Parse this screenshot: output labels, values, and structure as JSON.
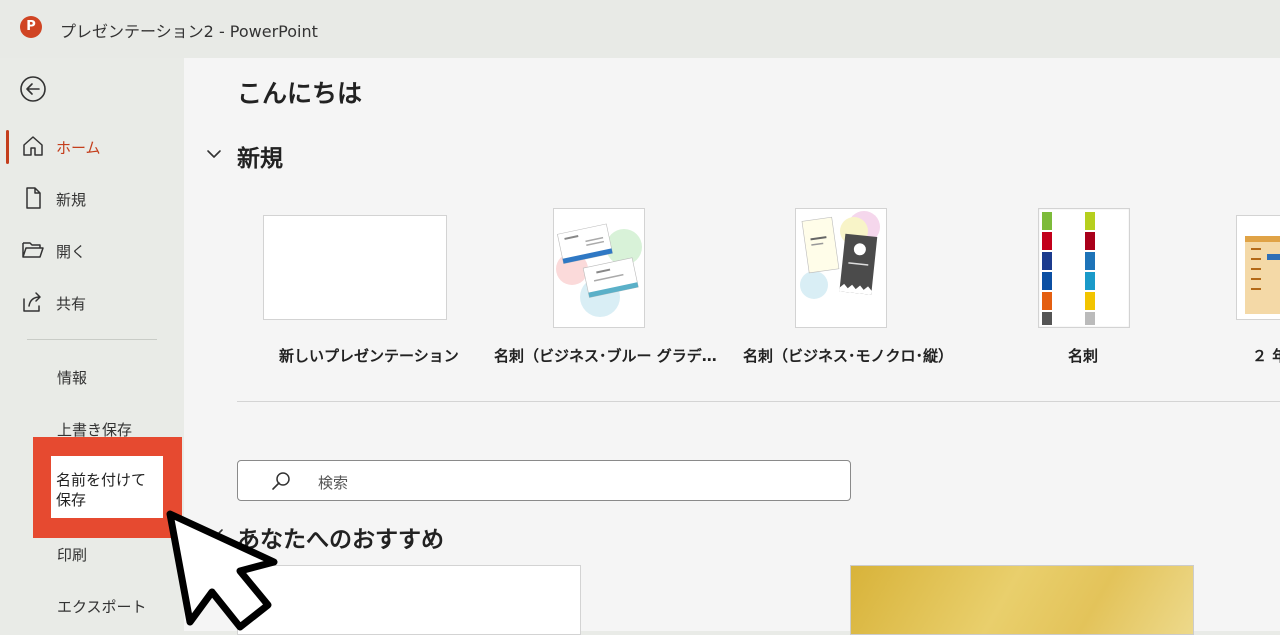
{
  "window": {
    "app_logo": "P",
    "title": "プレゼンテーション2  -  PowerPoint"
  },
  "sidebar": {
    "items": [
      {
        "label": "ホーム",
        "icon": "home-icon",
        "active": true
      },
      {
        "label": "新規",
        "icon": "new-document-icon"
      },
      {
        "label": "開く",
        "icon": "folder-open-icon"
      },
      {
        "label": "共有",
        "icon": "share-icon"
      }
    ],
    "sub_items": [
      {
        "label": "情報"
      },
      {
        "label": "上書き保存"
      },
      {
        "label": "名前を付けて保存"
      },
      {
        "label": "印刷"
      },
      {
        "label": "エクスポート"
      }
    ]
  },
  "main": {
    "greeting": "こんにちは",
    "new_section": {
      "title": "新規",
      "templates": [
        {
          "label": "新しいプレゼンテーション"
        },
        {
          "label": "名刺（ビジネス･ブルー グラデ…"
        },
        {
          "label": "名刺（ビジネス･モノクロ･縦）"
        },
        {
          "label": "名刺"
        },
        {
          "label": "２ 年"
        }
      ]
    },
    "search": {
      "placeholder": "検索"
    },
    "recommend": {
      "title": "あなたへのおすすめ"
    }
  },
  "colors": {
    "accent": "#c43e1c",
    "highlight": "#e64a30"
  }
}
